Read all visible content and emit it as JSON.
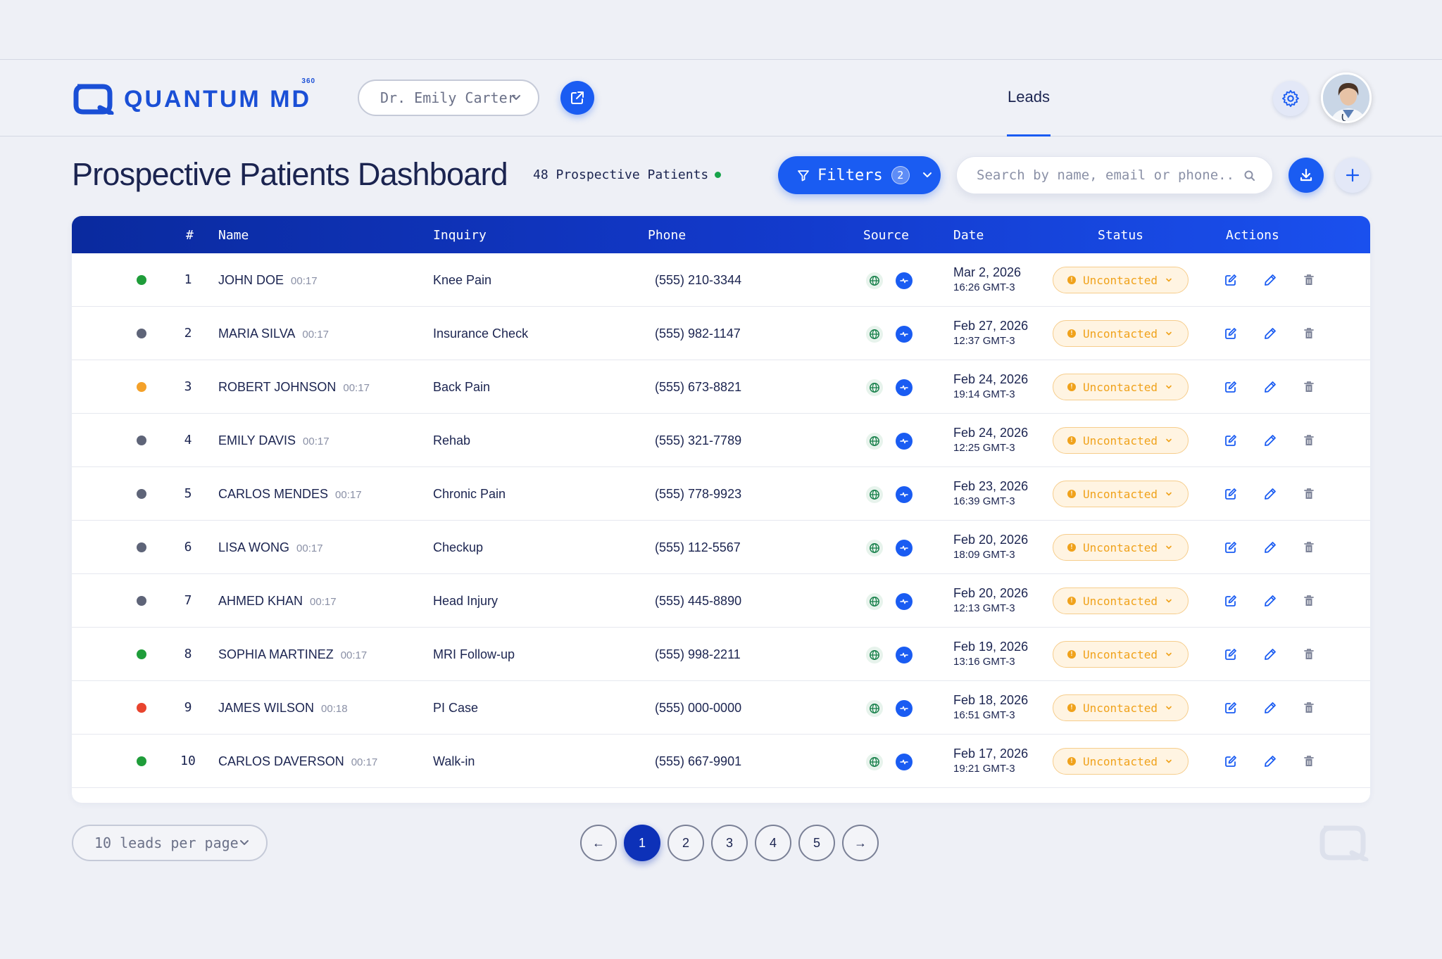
{
  "brand": {
    "name": "QUANTUM MD",
    "superscript": "360",
    "accent": "#1a5cf2",
    "dark": "#0d31b8"
  },
  "header": {
    "doctor_select": "Dr. Emily Carter",
    "tab": "Leads"
  },
  "page": {
    "title": "Prospective Patients Dashboard",
    "count_label": "48 Prospective Patients",
    "filters_label": "Filters",
    "filters_count": "2",
    "search_placeholder": "Search by name, email or phone..."
  },
  "table": {
    "columns": {
      "num": "#",
      "name": "Name",
      "inquiry": "Inquiry",
      "phone": "Phone",
      "source": "Source",
      "date": "Date",
      "status": "Status",
      "actions": "Actions"
    },
    "rows": [
      {
        "dot": "#1f9d3a",
        "num": "1",
        "name": "JOHN DOE",
        "dur": "00:17",
        "inquiry": "Knee Pain",
        "phone": "(555) 210-3344",
        "date": "Mar 2, 2026",
        "time": "16:26 GMT-3",
        "status": "Uncontacted"
      },
      {
        "dot": "#5e6478",
        "num": "2",
        "name": "MARIA SILVA",
        "dur": "00:17",
        "inquiry": "Insurance Check",
        "phone": "(555) 982-1147",
        "date": "Feb 27, 2026",
        "time": "12:37 GMT-3",
        "status": "Uncontacted"
      },
      {
        "dot": "#f4a12a",
        "num": "3",
        "name": "ROBERT JOHNSON",
        "dur": "00:17",
        "inquiry": "Back Pain",
        "phone": "(555) 673-8821",
        "date": "Feb 24, 2026",
        "time": "19:14 GMT-3",
        "status": "Uncontacted"
      },
      {
        "dot": "#5e6478",
        "num": "4",
        "name": "EMILY DAVIS",
        "dur": "00:17",
        "inquiry": "Rehab",
        "phone": "(555) 321-7789",
        "date": "Feb 24, 2026",
        "time": "12:25 GMT-3",
        "status": "Uncontacted"
      },
      {
        "dot": "#5e6478",
        "num": "5",
        "name": "CARLOS MENDES",
        "dur": "00:17",
        "inquiry": "Chronic Pain",
        "phone": "(555) 778-9923",
        "date": "Feb 23, 2026",
        "time": "16:39 GMT-3",
        "status": "Uncontacted"
      },
      {
        "dot": "#5e6478",
        "num": "6",
        "name": "LISA WONG",
        "dur": "00:17",
        "inquiry": "Checkup",
        "phone": "(555) 112-5567",
        "date": "Feb 20, 2026",
        "time": "18:09 GMT-3",
        "status": "Uncontacted"
      },
      {
        "dot": "#5e6478",
        "num": "7",
        "name": "AHMED KHAN",
        "dur": "00:17",
        "inquiry": "Head Injury",
        "phone": "(555) 445-8890",
        "date": "Feb 20, 2026",
        "time": "12:13 GMT-3",
        "status": "Uncontacted"
      },
      {
        "dot": "#1f9d3a",
        "num": "8",
        "name": "SOPHIA MARTINEZ",
        "dur": "00:17",
        "inquiry": "MRI Follow-up",
        "phone": "(555) 998-2211",
        "date": "Feb 19, 2026",
        "time": "13:16 GMT-3",
        "status": "Uncontacted"
      },
      {
        "dot": "#e8442e",
        "num": "9",
        "name": "JAMES WILSON",
        "dur": "00:18",
        "inquiry": "PI Case",
        "phone": "(555) 000-0000",
        "date": "Feb 18, 2026",
        "time": "16:51 GMT-3",
        "status": "Uncontacted"
      },
      {
        "dot": "#1f9d3a",
        "num": "10",
        "name": "CARLOS DAVERSON",
        "dur": "00:17",
        "inquiry": "Walk-in",
        "phone": "(555) 667-9901",
        "date": "Feb 17, 2026",
        "time": "19:21 GMT-3",
        "status": "Uncontacted"
      }
    ]
  },
  "footer": {
    "per_page": "10 leads per page",
    "prev": "←",
    "next": "→",
    "pages": [
      "1",
      "2",
      "3",
      "4",
      "5"
    ],
    "current_page": "1"
  },
  "icons": {
    "source_web": "globe-icon",
    "source_call": "phone-call-icon",
    "action_1": "edit-note-icon",
    "action_2": "pencil-icon",
    "action_3": "trash-icon"
  }
}
